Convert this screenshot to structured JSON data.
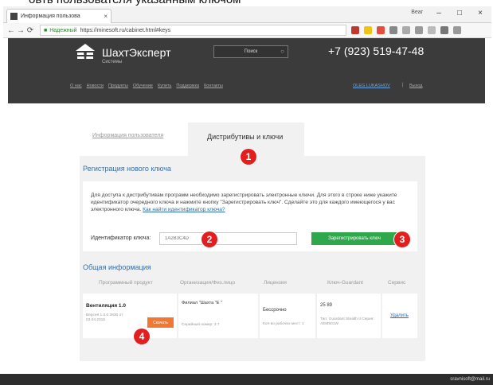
{
  "caption": "овть пользователя указанным ключом",
  "browser": {
    "tab_title": "Информация пользова",
    "tab_close": "×",
    "user_name": "Bear",
    "secure_label": "Надежный",
    "url": "https://minesoft.ru/cabinet.html#keys",
    "minimize": "–",
    "maximize": "□",
    "close": "×"
  },
  "header": {
    "brand": "ШахтЭксперт",
    "brand_sub": "Системы",
    "search_placeholder": "Поиск",
    "phone": "+7 (923) 519-47-48",
    "nav": [
      "О нас",
      "Новости",
      "Продукты",
      "Обучение",
      "Купить",
      "Поддержка",
      "Контакты"
    ],
    "user": "OLEG LUKASHOV",
    "separator": "|",
    "logout": "Выход"
  },
  "tabs": {
    "user_info": "Информация пользователя",
    "distributives": "Дистрибутивы и ключи"
  },
  "registration": {
    "title": "Регистрация нового ключа",
    "info_text": "Для доступа к дистрибутивам программ необходимо зарегистрировать электронные ключи. Для этого в строке ниже укажите идентификатор очередного ключа и нажмите кнопку \"Зарегистрировать ключ\". Сделайте это для каждого имеющегося у вас электронного ключа.",
    "how_link": "Как найти идентификатор ключа?",
    "key_label": "Идентификатор ключа:",
    "key_placeholder": "1A2B3C4D",
    "register_button": "Зарегистрировать ключ"
  },
  "general": {
    "title": "Общая информация",
    "columns": [
      "Программный продукт",
      "Организация/Физ.лицо",
      "Лицензия",
      "Ключ-Guardant",
      "Сервис"
    ],
    "row": {
      "product_name": "Вентиляция 1.0",
      "product_version": "Версия 1.0.0.3830 от 03.04.2015",
      "download": "Скачать",
      "org_name": "Филиал \"Шахта \"Е                    \"",
      "org_serial": "Серийный номер: 3   7",
      "license_term": "Бессрочно",
      "license_seats": "Кол-во рабочих мест: 1",
      "key_id": "25        89",
      "key_type": "Тип: Guardant Stealth II Серия: AEM501W",
      "update": "Удалить"
    }
  },
  "badges": [
    "1",
    "2",
    "3",
    "4"
  ],
  "footer": {
    "email": "sravnisoft@mail.ru"
  },
  "colors": {
    "header_bg": "#3b3b3b",
    "panel_bg": "#f1f1f1",
    "accent_blue": "#3a6ea5",
    "register_green": "#2ea84a",
    "download_orange": "#f07833",
    "badge_red": "#e31e1e"
  }
}
